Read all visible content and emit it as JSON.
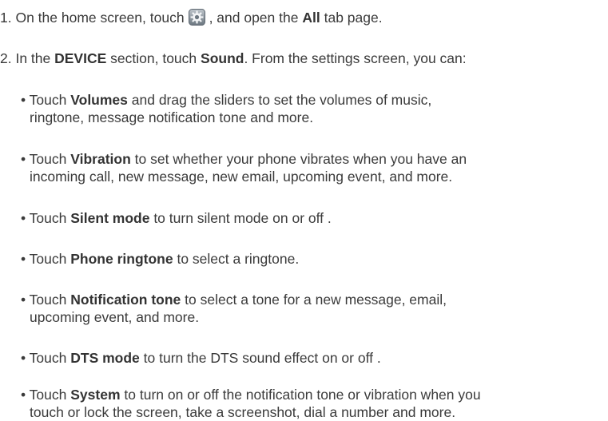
{
  "step1": {
    "part1": "1. On the home screen, touch",
    "icon": "settings-gear-icon",
    "part2": ", and open the",
    "bold": "All",
    "part3": "tab page."
  },
  "step2": {
    "part1": "2. In the",
    "bold1": "DEVICE",
    "part2": "section, touch",
    "bold2": "Sound",
    "part3": ". From the settings screen, you can:"
  },
  "bullets": [
    {
      "prefix": "• Touch",
      "bold": "Volumes",
      "line1": "and drag the sliders to set the volumes of music,",
      "line2": "ringtone, message notification tone and more."
    },
    {
      "prefix": "• Touch",
      "bold": "Vibration",
      "line1": "to set whether your phone vibrates when you have an",
      "line2": "incoming call, new message, new email, upcoming event, and more."
    },
    {
      "prefix": "• Touch",
      "bold": "Silent mode",
      "line1": "to turn silent mode on or off .",
      "line2": ""
    },
    {
      "prefix": "• Touch",
      "bold": "Phone ringtone",
      "line1": "to select a ringtone.",
      "line2": ""
    },
    {
      "prefix": "• Touch",
      "bold": "Notification tone",
      "line1": "to select a tone for a new message, email,",
      "line2": "upcoming event, and more."
    },
    {
      "prefix": "• Touch",
      "bold": "DTS mode",
      "line1": "to turn the DTS sound effect on or off .",
      "line2": ""
    },
    {
      "prefix": "• Touch",
      "bold": "System",
      "line1": "to turn on or off the notification tone or vibration when you",
      "line2": "touch or lock the screen, take a screenshot, dial a number and more."
    }
  ]
}
